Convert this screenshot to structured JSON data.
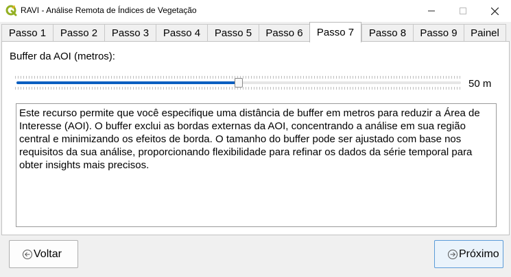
{
  "window": {
    "title": "RAVI - Análise Remota de Índices de Vegetação",
    "icon": "qgis-logo-icon"
  },
  "tabs": [
    {
      "label": "Passo 1",
      "active": false
    },
    {
      "label": "Passo 2",
      "active": false
    },
    {
      "label": "Passo 3",
      "active": false
    },
    {
      "label": "Passo 4",
      "active": false
    },
    {
      "label": "Passo 5",
      "active": false
    },
    {
      "label": "Passo 6",
      "active": false
    },
    {
      "label": "Passo 7",
      "active": true
    },
    {
      "label": "Passo 8",
      "active": false
    },
    {
      "label": "Passo 9",
      "active": false
    },
    {
      "label": "Painel",
      "active": false
    }
  ],
  "buffer": {
    "label": "Buffer da AOI (metros):",
    "value_text": "50 m",
    "slider_fraction": 0.5
  },
  "description": "Este recurso permite que você especifique uma distância de buffer em metros para reduzir a Área de Interesse (AOI). O buffer exclui as bordas externas da AOI, concentrando a análise em sua região central e minimizando os efeitos de borda. O tamanho do buffer pode ser ajustado com base nos requisitos da sua análise, proporcionando flexibilidade para refinar os dados da série temporal para obter insights mais precisos.",
  "buttons": {
    "back": {
      "label": "Voltar",
      "icon": "arrow-left-circle-icon"
    },
    "next": {
      "label": "Próximo",
      "icon": "arrow-right-circle-icon"
    }
  },
  "colors": {
    "accent": "#0a5ec0",
    "qgis_green": "#93b023"
  }
}
